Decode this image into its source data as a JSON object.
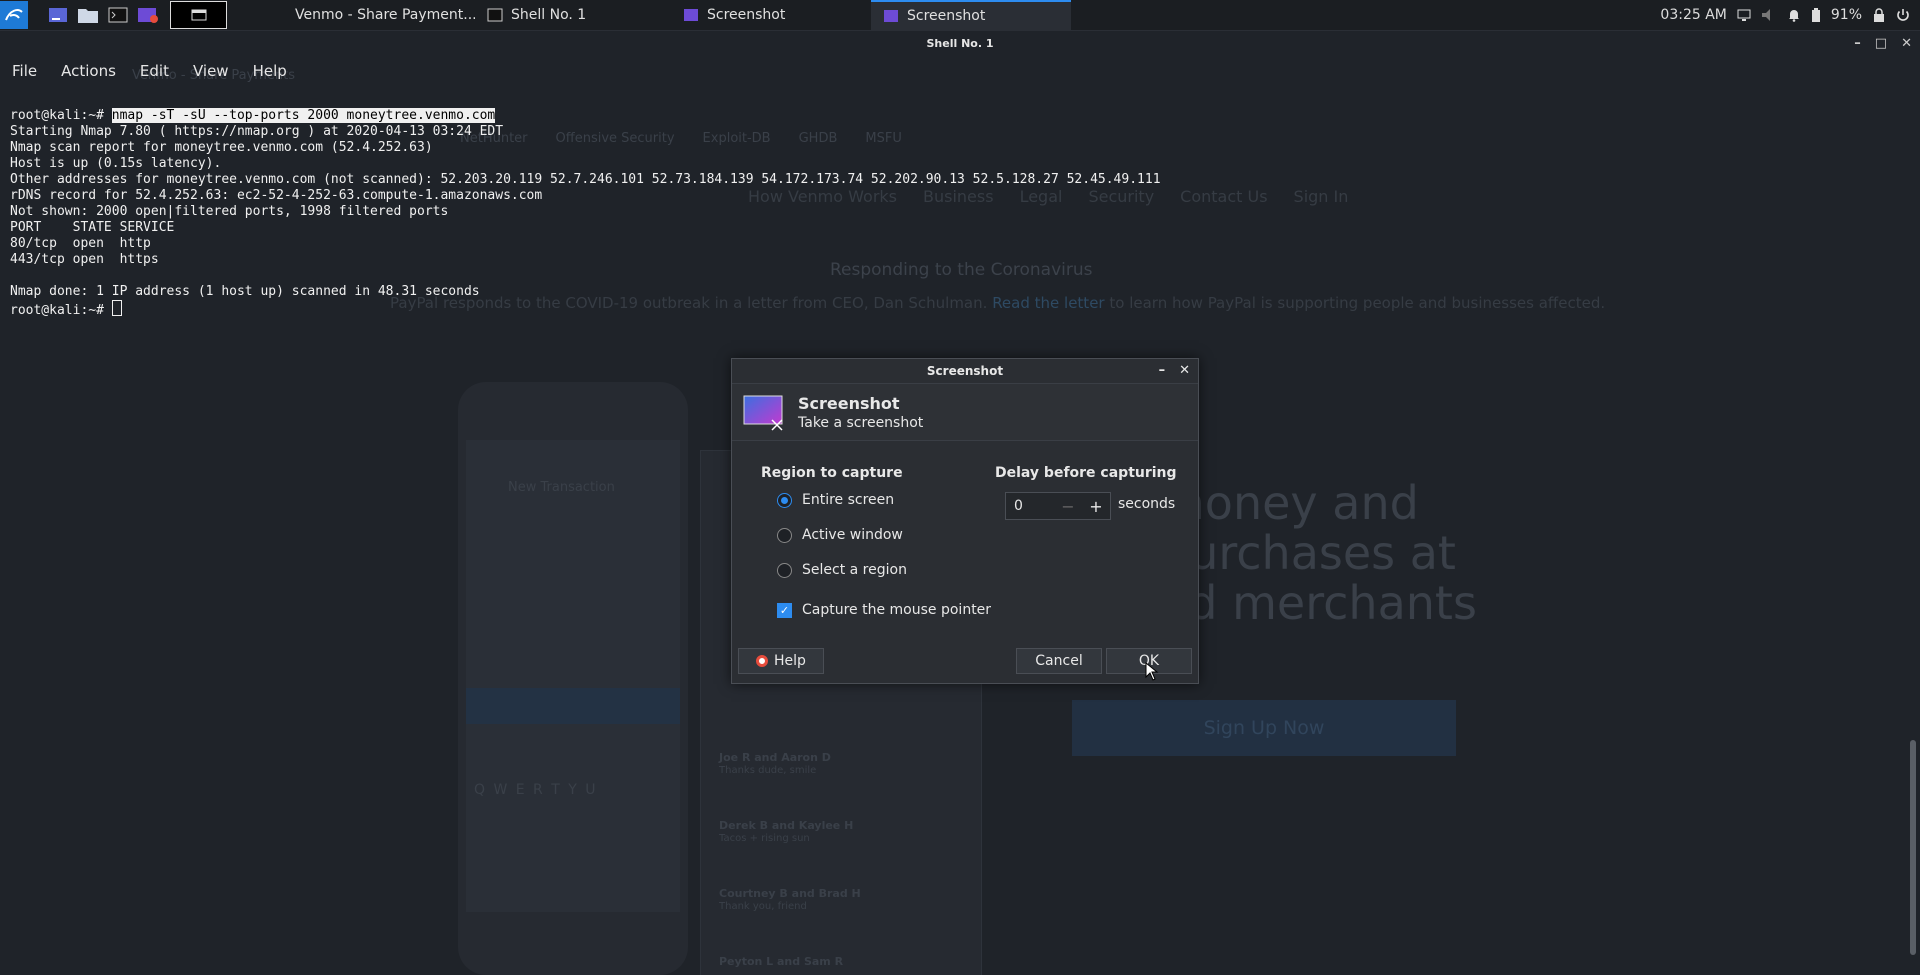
{
  "taskbar": {
    "tasks": [
      {
        "label": "Venmo - Share Payment...",
        "active": false
      },
      {
        "label": "Shell No. 1",
        "active": false
      },
      {
        "label": "Screenshot",
        "active": false
      },
      {
        "label": "Screenshot",
        "active": true
      }
    ],
    "clock": "03:25 AM",
    "battery": "91%"
  },
  "terminal": {
    "title": "Shell No. 1",
    "menu": [
      "File",
      "Actions",
      "Edit",
      "View",
      "Help"
    ],
    "prompt": "root@kali:~# ",
    "command": "nmap -sT -sU --top-ports 2000 moneytree.venmo.com",
    "output": [
      "Starting Nmap 7.80 ( https://nmap.org ) at 2020-04-13 03:24 EDT",
      "Nmap scan report for moneytree.venmo.com (52.4.252.63)",
      "Host is up (0.15s latency).",
      "Other addresses for moneytree.venmo.com (not scanned): 52.203.20.119 52.7.246.101 52.73.184.139 54.172.173.74 52.202.90.13 52.5.128.27 52.45.49.111",
      "rDNS record for 52.4.252.63: ec2-52-4-252-63.compute-1.amazonaws.com",
      "Not shown: 2000 open|filtered ports, 1998 filtered ports",
      "PORT    STATE SERVICE",
      "80/tcp  open  http",
      "443/tcp open  https",
      "",
      "Nmap done: 1 IP address (1 host up) scanned in 48.31 seconds"
    ],
    "final_prompt": "root@kali:~# "
  },
  "dialog": {
    "title": "Screenshot",
    "header_title": "Screenshot",
    "header_subtitle": "Take a screenshot",
    "region_label": "Region to capture",
    "regions": [
      {
        "label": "Entire screen",
        "selected": true
      },
      {
        "label": "Active window",
        "selected": false
      },
      {
        "label": "Select a region",
        "selected": false
      }
    ],
    "capture_pointer_label": "Capture the mouse pointer",
    "capture_pointer_checked": true,
    "delay_label": "Delay before capturing",
    "delay_value": "0",
    "delay_unit": "seconds",
    "help_label": "Help",
    "cancel_label": "Cancel",
    "ok_label": "OK"
  },
  "background": {
    "tab": "Venmo - Share Payments",
    "banner_title": "Responding to the Coronavirus",
    "banner_text": "PayPal responds to the COVID-19 outbreak in a letter from CEO, Dan Schulman.",
    "banner_link": "Read the letter",
    "banner_tail": "to learn how PayPal is supporting people and businesses affected.",
    "nav": [
      "How Venmo Works",
      "Business",
      "Legal",
      "Security",
      "Contact Us",
      "Sign In"
    ],
    "bookmarks": [
      "NetHunter",
      "Offensive Security",
      "Exploit-DB",
      "GHDB",
      "MSFU"
    ],
    "hero_lines": [
      "money and",
      "purchases at",
      "ed merchants"
    ],
    "cta": "Sign Up Now",
    "phone_header": "New Transaction",
    "keyboard_row": "Q W E R T Y U",
    "feed": [
      {
        "names": "Joe R and Aaron D",
        "note": "Thanks dude, smile"
      },
      {
        "names": "Derek B and Kaylee H",
        "note": "Tacos + rising sun"
      },
      {
        "names": "Courtney B and Brad H",
        "note": "Thank you, friend"
      },
      {
        "names": "Peyton L and Sam R",
        "note": ""
      }
    ]
  }
}
